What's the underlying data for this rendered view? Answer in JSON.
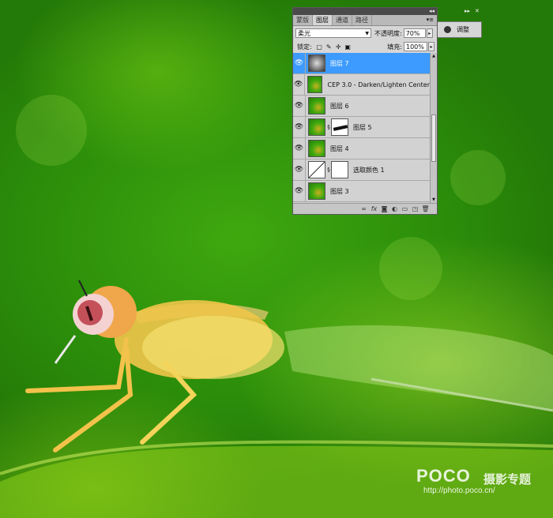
{
  "panel": {
    "tabs": [
      "蒙版",
      "图层",
      "通道",
      "路径"
    ],
    "active_tab": 1,
    "blend_mode": "柔光",
    "opacity_label": "不透明度:",
    "opacity_value": "70%",
    "lock_label": "锁定:",
    "fill_label": "填充:",
    "fill_value": "100%",
    "layers": [
      {
        "name": "图层 7",
        "thumb": "gray",
        "selected": true,
        "mask": false
      },
      {
        "name": "CEP 3.0 - Darken/Lighten Center",
        "thumb": "green",
        "selected": false,
        "mask": false
      },
      {
        "name": "图层 6",
        "thumb": "green",
        "selected": false,
        "mask": false
      },
      {
        "name": "图层 5",
        "thumb": "green",
        "selected": false,
        "mask": true
      },
      {
        "name": "图层 4",
        "thumb": "green",
        "selected": false,
        "mask": false
      },
      {
        "name": "选取颜色 1",
        "thumb": "adjust",
        "selected": false,
        "mask": true
      },
      {
        "name": "图层 3",
        "thumb": "green",
        "selected": false,
        "mask": false
      }
    ]
  },
  "adjustments": {
    "label": "调整"
  },
  "watermark": {
    "logo": "POCO",
    "sub": "摄影专题",
    "url": "http://photo.poco.cn/"
  }
}
